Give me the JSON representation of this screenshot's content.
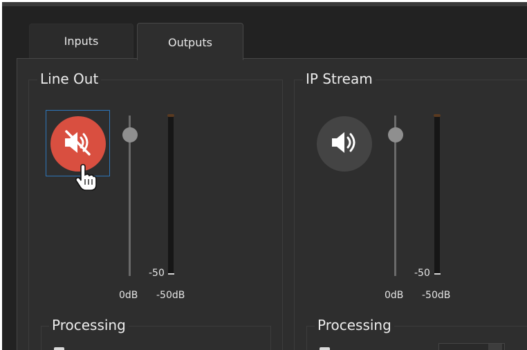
{
  "tabs": [
    {
      "label": "Inputs",
      "active": false
    },
    {
      "label": "Outputs",
      "active": true
    }
  ],
  "line_out": {
    "title": "Line Out",
    "muted": true,
    "button_icon": "speaker-muted-icon",
    "slider_label": "0dB",
    "meter_label": "-50dB",
    "meter_tick": "-50",
    "processing_title": "Processing"
  },
  "ip_stream": {
    "title": "IP Stream",
    "muted": false,
    "button_icon": "speaker-icon",
    "slider_label": "0dB",
    "meter_label": "-50dB",
    "meter_tick": "-50",
    "processing_title": "Processing"
  },
  "colors": {
    "mute_active": "#d94f40",
    "focus_ring": "#2e78bd",
    "panel_bg": "#2e2e2e"
  }
}
